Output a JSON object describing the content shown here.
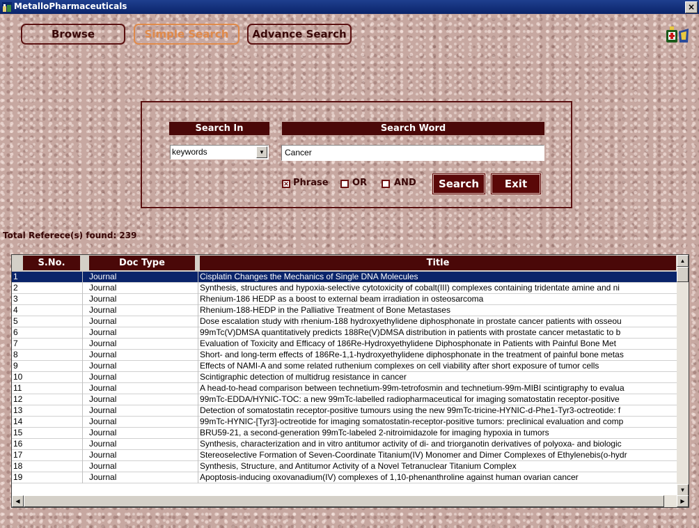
{
  "window": {
    "title": "MetalloPharmaceuticals",
    "close_label": "×"
  },
  "nav": {
    "browse_label": "Browse",
    "simple_search_label": "Simple Search",
    "advance_search_label": "Advance Search"
  },
  "search": {
    "search_in_header": "Search In",
    "search_word_header": "Search Word",
    "search_in_value": "keywords",
    "search_word_value": "Cancer",
    "phrase_label": "Phrase",
    "or_label": "OR",
    "and_label": "AND",
    "phrase_checked": true,
    "or_checked": false,
    "and_checked": false,
    "search_button": "Search",
    "exit_button": "Exit"
  },
  "results": {
    "total_text": "Total Referece(s) found:  239",
    "columns": [
      "S.No.",
      "Doc Type",
      "Title"
    ],
    "rows": [
      [
        "1",
        "Journal",
        "Cisplatin Changes the Mechanics of Single DNA Molecules"
      ],
      [
        "2",
        "Journal",
        "Synthesis, structures and hypoxia-selective cytotoxicity of cobalt(III) complexes containing tridentate amine and ni"
      ],
      [
        "3",
        "Journal",
        "Rhenium-186 HEDP as a boost to external beam irradiation in osteosarcoma"
      ],
      [
        "4",
        "Journal",
        "Rhenium-188-HEDP in the Palliative Treatment of Bone Metastases"
      ],
      [
        "5",
        "Journal",
        "Dose escalation study with rhenium-188 hydroxyethylidene diphosphonate in prostate cancer patients with osseou"
      ],
      [
        "6",
        "Journal",
        "99mTc(V)DMSA quantitatively predicts 188Re(V)DMSA distribution in patients with prostate cancer metastatic to b"
      ],
      [
        "7",
        "Journal",
        "Evaluation of Toxicity and Efficacy of 186Re-Hydroxyethylidene Diphosphonate in Patients with Painful Bone Met"
      ],
      [
        "8",
        "Journal",
        "Short- and long-term effects of 186Re-1,1-hydroxyethylidene diphosphonate in the treatment of painful bone metas"
      ],
      [
        "9",
        "Journal",
        "Effects of NAMI-A and some related ruthenium complexes on cell viability after short exposure of tumor cells"
      ],
      [
        "10",
        "Journal",
        "Scintigraphic detection of multidrug resistance in cancer"
      ],
      [
        "11",
        "Journal",
        "A head-to-head comparison between technetium-99m-tetrofosmin and technetium-99m-MIBI scintigraphy to evalua"
      ],
      [
        "12",
        "Journal",
        "99mTc-EDDA/HYNIC-TOC: a new 99mTc-labelled radiopharmaceutical for imaging somatostatin receptor-positive"
      ],
      [
        "13",
        "Journal",
        "Detection of somatostatin receptor-positive tumours using the new 99mTc-tricine-HYNIC-d-Phe1-Tyr3-octreotide: f"
      ],
      [
        "14",
        "Journal",
        "99mTc-HYNIC-[Tyr3]-octreotide for imaging somatostatin-receptor-positive tumors: preclinical evaluation and comp"
      ],
      [
        "15",
        "Journal",
        "BRU59-21, a second-generation 99mTc-labeled 2-nitroimidazole for imaging hypoxia in tumors"
      ],
      [
        "16",
        "Journal",
        "Synthesis, characterization and in vitro antitumor activity of di- and triorganotin derivatives of polyoxa- and biologic"
      ],
      [
        "17",
        "Journal",
        "Stereoselective Formation of Seven-Coordinate Titanium(IV) Monomer and Dimer Complexes of Ethylenebis(o-hydr"
      ],
      [
        "18",
        "Journal",
        "Synthesis, Structure, and Antitumor Activity of a Novel Tetranuclear Titanium Complex"
      ],
      [
        "19",
        "Journal",
        "Apoptosis-inducing oxovanadium(IV) complexes of 1,10-phenanthroline against human ovarian cancer"
      ]
    ]
  }
}
